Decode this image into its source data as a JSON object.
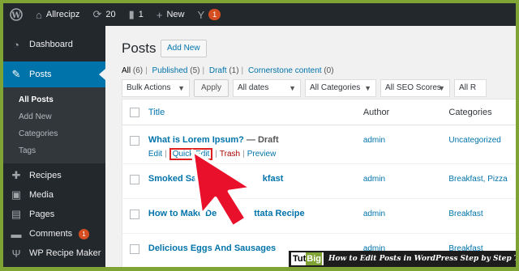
{
  "adminbar": {
    "site_name": "Allrecipz",
    "updates_count": "20",
    "comments_count": "1",
    "new_label": "New",
    "plugin_badge": "1"
  },
  "sidebar": {
    "dashboard": "Dashboard",
    "posts": "Posts",
    "submenu": [
      "All Posts",
      "Add New",
      "Categories",
      "Tags"
    ],
    "recipes": "Recipes",
    "media": "Media",
    "pages": "Pages",
    "comments": "Comments",
    "comments_badge": "1",
    "recipe_maker": "WP Recipe Maker"
  },
  "main": {
    "title": "Posts",
    "add_new": "Add New",
    "views": {
      "all": "All",
      "all_count": "(6)",
      "published": "Published",
      "published_count": "(5)",
      "draft": "Draft",
      "draft_count": "(1)",
      "cornerstone": "Cornerstone content",
      "cornerstone_count": "(0)"
    },
    "filters": {
      "bulk_actions": "Bulk Actions",
      "apply": "Apply",
      "dates": "All dates",
      "categories": "All Categories",
      "seo": "All SEO Scores",
      "readability": "All R"
    },
    "table": {
      "headers": {
        "title": "Title",
        "author": "Author",
        "categories": "Categories"
      },
      "rows": [
        {
          "title": "What is Lorem Ipsum?",
          "state": "— Draft",
          "author": "admin",
          "categories": "Uncategorized"
        },
        {
          "title": "Smoked Salmo",
          "title_tail": "kfast",
          "author": "admin",
          "categories": "Breakfast, Pizza"
        },
        {
          "title": "How to Make De",
          "title_tail": "ttata Recipe",
          "author": "admin",
          "categories": "Breakfast"
        },
        {
          "title": "Delicious Eggs And Sausages",
          "author": "admin",
          "categories": "Breakfast"
        }
      ],
      "row_actions": {
        "edit": "Edit",
        "quick_edit": "Quick Edit",
        "trash": "Trash",
        "preview": "Preview"
      }
    }
  },
  "watermark": {
    "logo_a": "Tut",
    "logo_b": "Big",
    "caption": "How to Edit Posts in WordPress Step by Step Tutorial"
  },
  "colors": {
    "frame": "#7fa334",
    "accent": "#0073aa",
    "adminbar": "#23282d",
    "highlight": "#e02020"
  }
}
